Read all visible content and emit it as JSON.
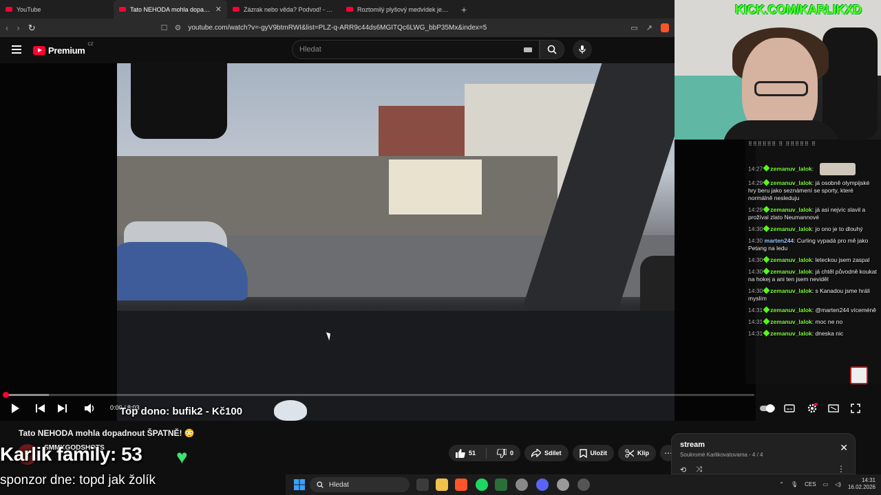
{
  "browser": {
    "tabs": [
      {
        "title": "YouTube",
        "active": false
      },
      {
        "title": "Tato NEHODA mohla dopadnout ŠPATNĚ!",
        "active": true
      },
      {
        "title": "Zázrak nebo věda? Podvod! - YouTube",
        "active": false
      },
      {
        "title": "Roztomilý plyšový medvídek je zároveň",
        "active": false
      }
    ],
    "new_tab": "+",
    "url": "youtube.com/watch?v=-gyV9btmRWI&list=PLZ-q-ARR9c44ds6MGITQc6LWG_bbP35Mx&index=5"
  },
  "youtube": {
    "brand": "Premium",
    "country": "CZ",
    "search_placeholder": "Hledat",
    "video": {
      "title": "Tato NEHODA mohla dopadnout ŠPATNĚ! 😳",
      "time": "0:00 / 8:03",
      "progress": 0.006,
      "buffered": 0.06,
      "channel": "SMMKGODSHOTS",
      "likes": "51",
      "dislikes": "0",
      "share": "Sdílet",
      "save": "Uložit",
      "clip": "Klip",
      "more": "⋯"
    },
    "playlist": {
      "title": "stream",
      "meta": "Soukromé  Karlikovatovama - 4 / 4",
      "close": "✕",
      "more": "⋮"
    }
  },
  "overlays": {
    "donor": "Top dono: bufik2 - Kč100",
    "family": "Karlik family: 53",
    "heart": "♥",
    "sponsor": "sponzor dne: topd jak žolík",
    "kick": "KICK.COM/KARLIKXD"
  },
  "chat": {
    "header_dots": "⠿⠿⠿⠿⠿⠿ ⠿ ⠿⠿⠿⠿⠿ ⠿",
    "messages": [
      {
        "time": "14:27",
        "user": "zemanuv_lalok",
        "text": "",
        "emote": true
      },
      {
        "time": "14:29",
        "user": "zemanuv_lalok",
        "text": "já osobně olympijské hry beru jako seznámení se sporty, které normálně nesleduju"
      },
      {
        "time": "14:29",
        "user": "zemanuv_lalok",
        "text": "já asi nejvíc slavil a prožíval zlato Neumannové"
      },
      {
        "time": "14:30",
        "user": "zemanuv_lalok",
        "text": "jo ono je to dlouhý"
      },
      {
        "time": "14:30",
        "user": "marten244",
        "text": "Curling vypadá pro mě jako Petang na ledu"
      },
      {
        "time": "14:30",
        "user": "zemanuv_lalok",
        "text": "leteckou jsem zaspal"
      },
      {
        "time": "14:30",
        "user": "zemanuv_lalok",
        "text": "já chtěl původně koukat na hokej a ani ten jsem neviděl"
      },
      {
        "time": "14:30",
        "user": "zemanuv_lalok",
        "text": "s Kanadou jsme hráli myslím"
      },
      {
        "time": "14:31",
        "user": "zemanuv_lalok",
        "text": "@marten244 víceméně"
      },
      {
        "time": "14:31",
        "user": "zemanuv_lalok",
        "text": "moc ne no"
      },
      {
        "time": "14:31",
        "user": "zemanuv_lalok",
        "text": "dneska nic"
      }
    ]
  },
  "taskbar": {
    "search": "Hledat",
    "lang": "CES",
    "time": "14:31",
    "date": "16.02.2026"
  }
}
